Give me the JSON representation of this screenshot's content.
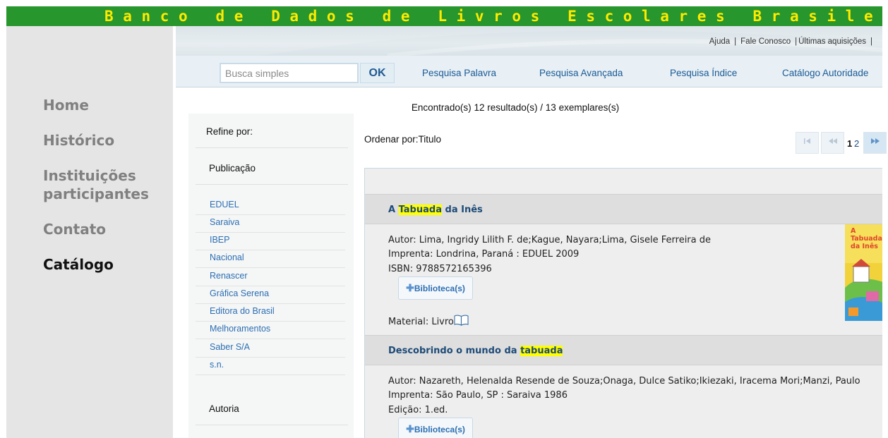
{
  "header": {
    "title": "Banco de Dados de Livros Escolares Brasileiros"
  },
  "sidebar": {
    "items": [
      {
        "label": "Home"
      },
      {
        "label": "Histórico"
      },
      {
        "label": "Instituições participantes"
      },
      {
        "label": "Contato"
      },
      {
        "label": "Catálogo"
      }
    ]
  },
  "top_links": {
    "help": "Ajuda",
    "contact": "Fale Conosco",
    "acquisitions": "Últimas aquisições"
  },
  "search": {
    "placeholder": "Busca simples",
    "ok_label": "OK",
    "menu": [
      "Pesquisa Palavra",
      "Pesquisa Avançada",
      "Pesquisa Índice",
      "Catálogo Autoridade"
    ]
  },
  "results_summary": {
    "prefix": "Encontrado(s)",
    "count_results": "12",
    "mid": "resultado(s) /",
    "count_copies": "13",
    "suffix": "exemplares(s)"
  },
  "refine": {
    "title": "Refine por:",
    "publication_heading": "Publicação",
    "publishers": [
      "EDUEL",
      "Saraiva",
      "IBEP",
      "Nacional",
      "Renascer",
      "Gráfica Serena",
      "Editora do Brasil",
      "Melhoramentos",
      "Saber S/A",
      "s.n."
    ],
    "author_heading": "Autoria"
  },
  "sort": {
    "label": "Ordenar por:Titulo"
  },
  "pagination": {
    "pages": [
      "1",
      "2"
    ],
    "current": "1"
  },
  "results": [
    {
      "title_before": "A ",
      "title_highlight": "Tabuada",
      "title_after": " da Inês",
      "author": "Autor: Lima, Ingridy Lilith F. de;Kague, Nayara;Lima, Gisele Ferreira de",
      "imprint": "Imprenta: Londrina, Paraná : EDUEL 2009",
      "isbn": "ISBN: 9788572165396",
      "library_button": "Biblioteca(s)",
      "material": "Material: Livro",
      "cover_text": "A Tabuada da Inês"
    },
    {
      "title_before": "Descobrindo o mundo da ",
      "title_highlight": "tabuada",
      "title_after": "",
      "author": "Autor: Nazareth, Helenalda Resende de Souza;Onaga, Dulce Satiko;Ikiezaki, Iracema Mori;Manzi, Paulo",
      "imprint": "Imprenta: São Paulo, SP : Saraiva 1986",
      "edition": "Edição: 1.ed.",
      "library_button": "Biblioteca(s)"
    }
  ]
}
